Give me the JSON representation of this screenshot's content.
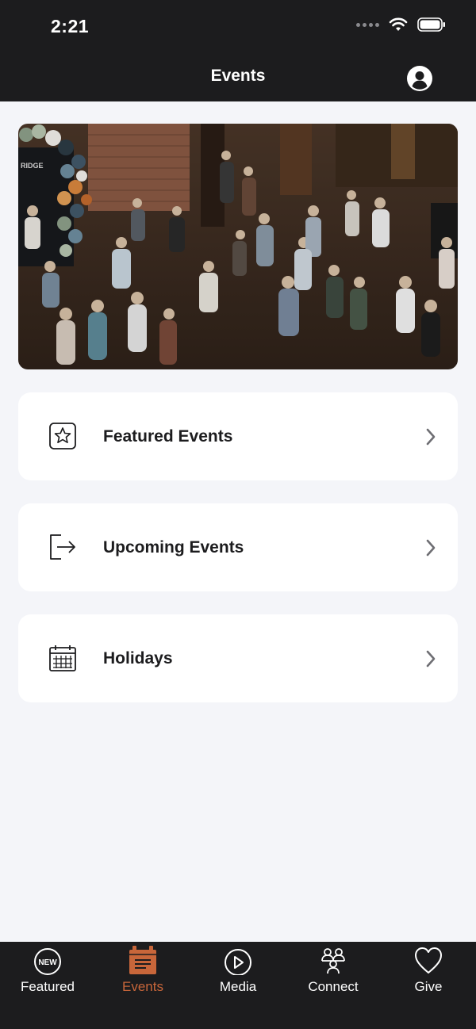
{
  "status_bar": {
    "time": "2:21"
  },
  "header": {
    "title": "Events"
  },
  "menu": [
    {
      "label": "Featured Events",
      "icon": "star-box-icon"
    },
    {
      "label": "Upcoming Events",
      "icon": "exit-arrow-icon"
    },
    {
      "label": "Holidays",
      "icon": "calendar-icon"
    }
  ],
  "tabs": [
    {
      "label": "Featured",
      "icon": "new-badge-icon",
      "badge": "NEW"
    },
    {
      "label": "Events",
      "icon": "calendar-tab-icon",
      "active": true
    },
    {
      "label": "Media",
      "icon": "play-icon"
    },
    {
      "label": "Connect",
      "icon": "people-icon"
    },
    {
      "label": "Give",
      "icon": "heart-icon"
    }
  ],
  "colors": {
    "bar_background": "#1c1c1e",
    "page_background": "#f4f5f9",
    "accent": "#c8663a"
  }
}
